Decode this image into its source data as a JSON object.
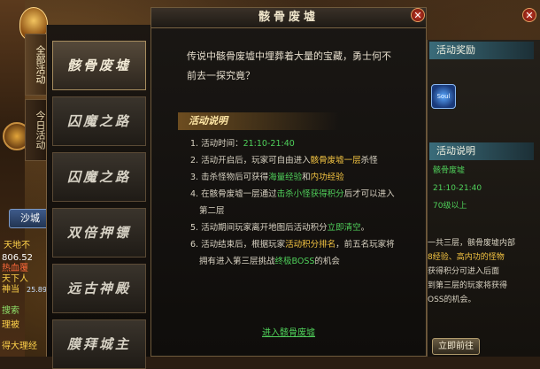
{
  "hud": {
    "left_texts": [
      "天地不",
      "806.52",
      "热血覆",
      "天下人",
      "神当",
      "搜索",
      "理被",
      "得大理经"
    ],
    "map_button": "沙城",
    "coord": "25.897"
  },
  "category_tabs": [
    {
      "label": "全部活动",
      "active": true
    },
    {
      "label": "今日活动",
      "active": false
    }
  ],
  "activity_list": [
    {
      "label": "骸骨废墟",
      "active": true
    },
    {
      "label": "囚魔之路",
      "active": false
    },
    {
      "label": "囚魔之路",
      "active": false
    },
    {
      "label": "双倍押镖",
      "active": false
    },
    {
      "label": "远古神殿",
      "active": false
    },
    {
      "label": "膜拜城主",
      "active": false
    }
  ],
  "dialog": {
    "title": "骸骨废墟",
    "close_symbol": "✕",
    "intro_line1": "传说中骸骨废墟中埋葬着大量的宝藏，勇士何不",
    "intro_line2": "前去一探究竟？",
    "section_title": "活动说明",
    "rules": {
      "r1_prefix": "1. 活动时间：",
      "r1_time": "21:10-21:40",
      "r2_prefix": "2. 活动开启后，玩家可自由进入",
      "r2_hl": "骸骨废墟一层",
      "r2_suffix": "杀怪",
      "r3_prefix": "3. 击杀怪物后可获得",
      "r3_hl1": "海量经验",
      "r3_mid": "和",
      "r3_hl2": "内功经验",
      "r4_prefix": "4. 在骸骨废墟一层通过",
      "r4_hl": "击杀小怪获得积分",
      "r4_suffix": "后才可以进入",
      "r4_line2": "第二层",
      "r5_prefix": "5. 活动期间玩家离开地图后活动积分",
      "r5_hl": "立即清空",
      "r5_suffix": "。",
      "r6_prefix": "6. 活动结束后，根据玩家",
      "r6_hl1": "活动积分排名",
      "r6_mid": "，前五名玩家将",
      "r6_line2_prefix": "拥有进入第三层挑战",
      "r6_hl2": "终极BOSS",
      "r6_line2_suffix": "的机会"
    },
    "enter_link": "进入骸骨废墟"
  },
  "right_panel": {
    "reward_header": "活动奖励",
    "reward_icon_text": "Soul",
    "desc_header": "活动说明",
    "lines": [
      "骸骨废墟",
      "21:10-21:40",
      "70级以上"
    ],
    "text_lines": [
      "一共三层，骸骨废墟内部",
      "8经验、高内功的怪物",
      "获得积分可进入后面",
      "到第三层的玩家将获得",
      "OSS的机会。"
    ],
    "go_button": "立即前往"
  },
  "colors": {
    "highlight_yellow": "#f5c542",
    "highlight_green": "#4fd05a",
    "highlight_red": "#e24a3a",
    "close_red": "#c73a28"
  }
}
